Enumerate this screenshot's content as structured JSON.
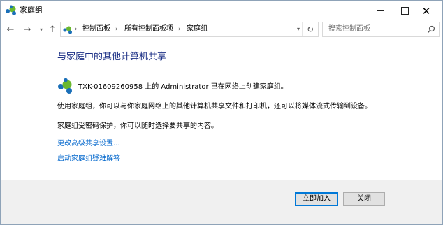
{
  "window": {
    "title": "家庭组",
    "controls": {
      "minimize": "minimize",
      "maximize": "maximize",
      "close": "✕"
    }
  },
  "navigation": {
    "back_icon": "arrow-left-icon",
    "forward_icon": "arrow-right-icon",
    "up_icon": "arrow-up-icon",
    "breadcrumbs": [
      "控制面板",
      "所有控制面板项",
      "家庭组"
    ],
    "search_placeholder": "搜索控制面板"
  },
  "content": {
    "heading": "与家庭中的其他计算机共享",
    "status": "TXK-01609260958 上的 Administrator 已在网络上创建家庭组。",
    "paragraph1": "使用家庭组，你可以与你家庭网络上的其他计算机共享文件和打印机，还可以将媒体流式传输到设备。",
    "paragraph2": "家庭组受密码保护，你可以随时选择要共享的内容。",
    "links": [
      "更改高级共享设置...",
      "启动家庭组疑难解答"
    ]
  },
  "footer": {
    "join_button": "立即加入",
    "close_button": "关闭"
  },
  "colors": {
    "heading": "#1e3287",
    "link": "#0066cc",
    "accent": "#0078d7",
    "homegroup_blue": "#1a6fb8",
    "homegroup_green": "#6ab82e"
  }
}
